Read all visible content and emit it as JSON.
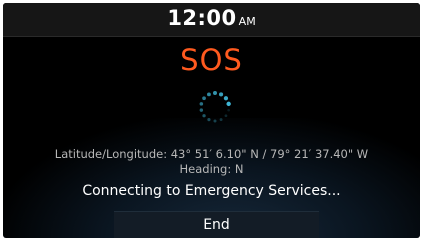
{
  "status_bar": {
    "time": "12:00",
    "ampm": "AM"
  },
  "title": "SOS",
  "spinner": {
    "icon": "loading-spinner-icon",
    "color": "#3fb6d6"
  },
  "location": {
    "coordinates": "Latitude/Longitude:  43° 51′  6.10\" N  / 79° 21′  37.40\" W",
    "heading": "Heading: N"
  },
  "status_message": "Connecting to Emergency Services...",
  "end_button_label": "End",
  "colors": {
    "title": "#ff5a1f",
    "background": "#000000",
    "text_secondary": "#b7b7b7"
  }
}
